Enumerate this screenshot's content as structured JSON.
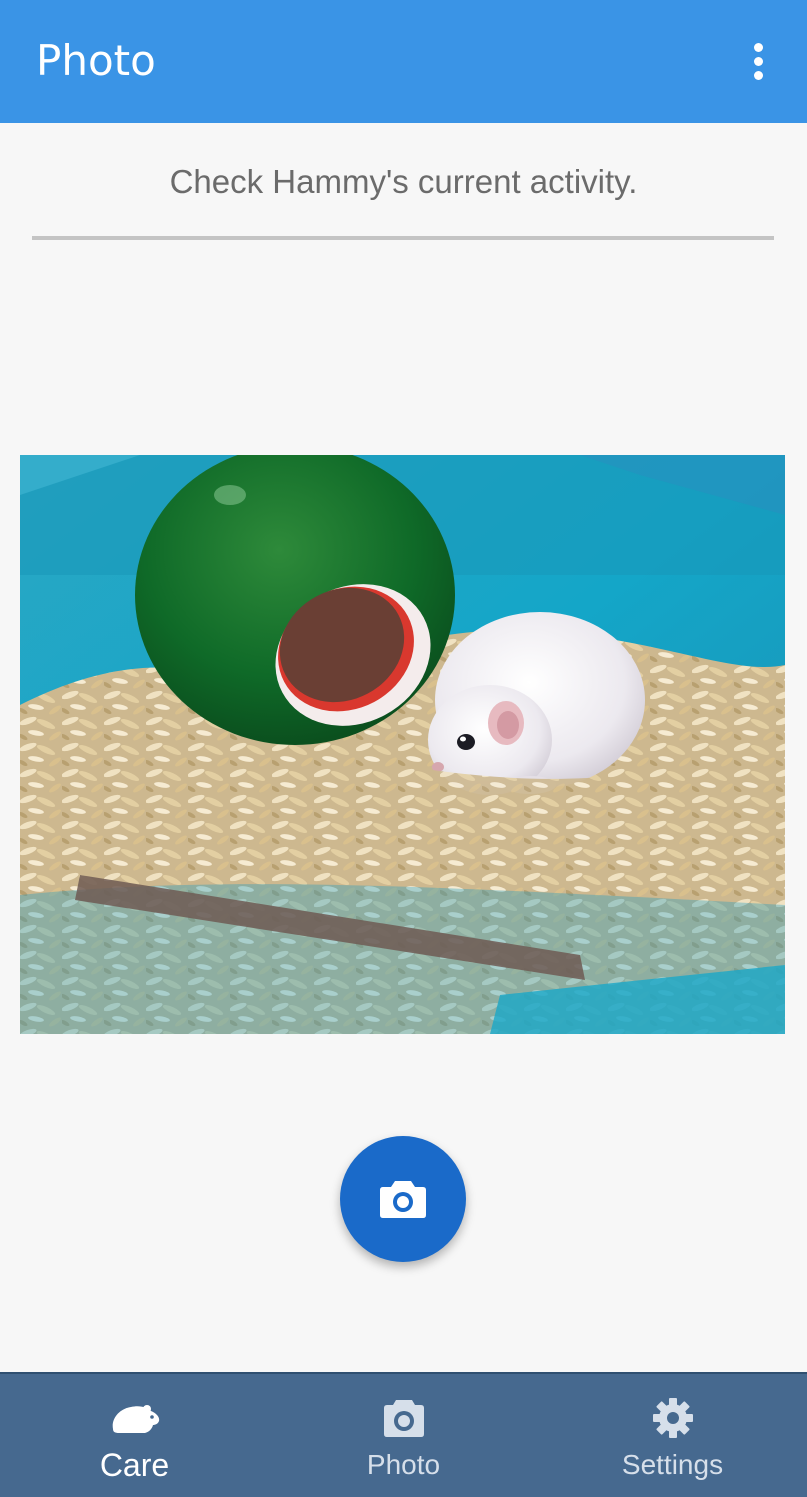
{
  "app_bar": {
    "title": "Photo",
    "more_icon": "more-vert-icon"
  },
  "main": {
    "subtitle": "Check Hammy's current activity.",
    "photo": {
      "subject": "hamster"
    },
    "capture_icon": "camera-icon"
  },
  "bottom_nav": {
    "items": [
      {
        "label": "Care",
        "icon": "hamster-icon",
        "active": true
      },
      {
        "label": "Photo",
        "icon": "camera-icon",
        "active": false
      },
      {
        "label": "Settings",
        "icon": "gear-icon",
        "active": false
      }
    ]
  },
  "colors": {
    "app_bar": "#3a94e6",
    "fab": "#1a6ac9",
    "bottom_nav": "#46698f",
    "background": "#f7f7f7"
  }
}
